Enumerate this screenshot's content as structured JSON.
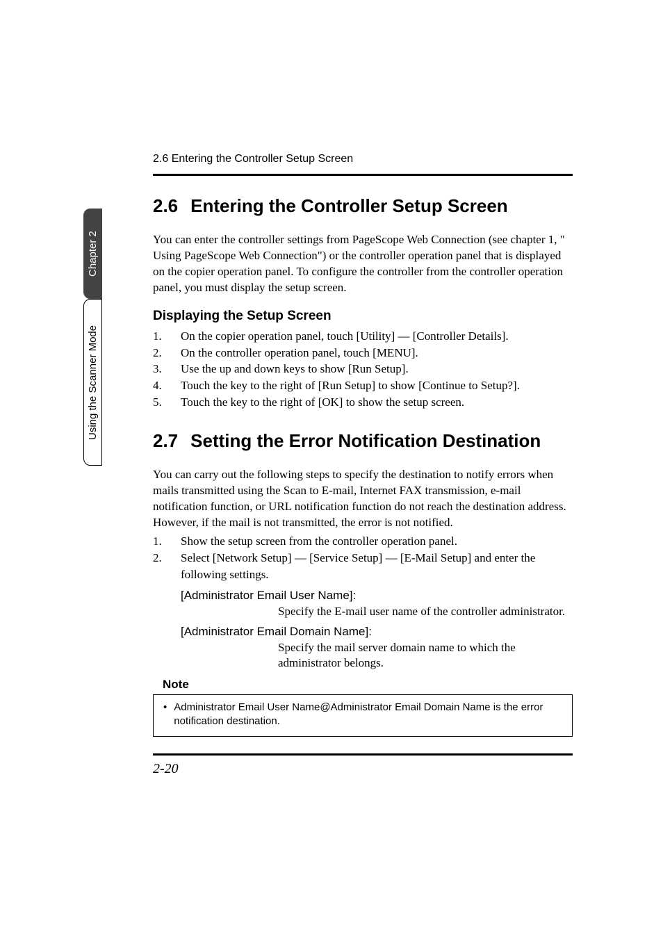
{
  "running_head": "2.6  Entering the Controller Setup Screen",
  "side_tabs": {
    "chapter": "Chapter 2",
    "mode": "Using the Scanner Mode"
  },
  "section26": {
    "number": "2.6",
    "title": "Entering the Controller Setup Screen",
    "intro": "You can enter the controller settings from PageScope Web Connection (see chapter 1, \" Using PageScope Web Connection\") or the controller operation panel that is displayed on the copier operation panel. To configure the controller from the controller operation panel, you must display the setup screen.",
    "subhead": "Displaying the Setup Screen",
    "steps": [
      "On the copier operation panel, touch [Utility] — [Controller Details].",
      "On the controller operation panel, touch [MENU].",
      "Use the up and down keys to show [Run Setup].",
      "Touch the key to the right of [Run Setup] to show [Continue to Setup?].",
      "Touch the key to the right of [OK] to show the setup screen."
    ]
  },
  "section27": {
    "number": "2.7",
    "title": "Setting the Error Notification Destination",
    "intro": "You can carry out the following steps to specify the destination to notify errors when mails transmitted using the Scan to E-mail, Internet FAX transmission, e-mail notification function, or URL notification function do not reach the destination address. However, if the mail is not transmitted, the error is not notified.",
    "steps": [
      "Show the setup screen from the controller operation panel.",
      "Select [Network Setup] — [Service Setup] — [E-Mail Setup] and enter the following settings."
    ],
    "defs": [
      {
        "term": "[Administrator Email User Name]:",
        "desc": "Specify the E-mail user name of the controller administrator."
      },
      {
        "term": "[Administrator Email Domain Name]:",
        "desc": "Specify the mail server domain name to which the administrator belongs."
      }
    ]
  },
  "note": {
    "label": "Note",
    "text": "Administrator Email User Name@Administrator Email Domain Name is the error notification destination."
  },
  "page_number": "2-20"
}
